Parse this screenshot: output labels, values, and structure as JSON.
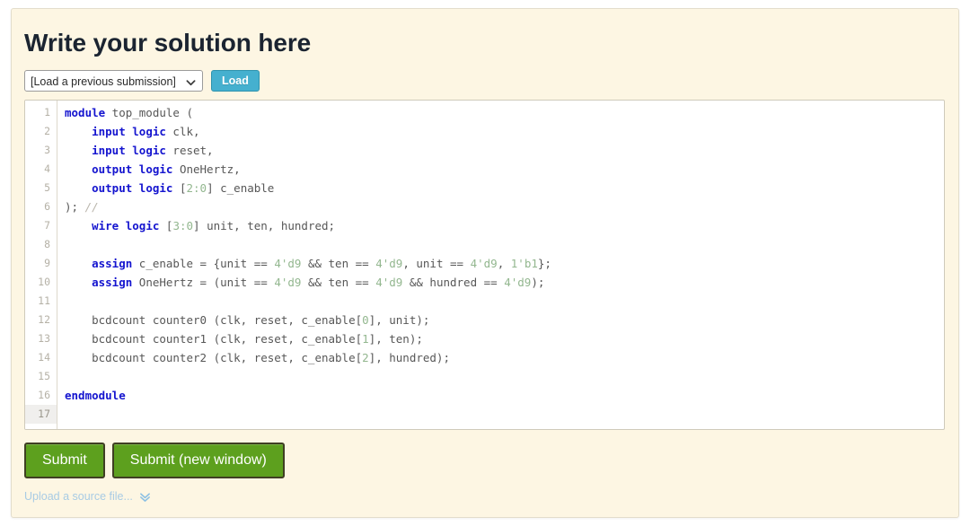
{
  "panel": {
    "title": "Write your solution here"
  },
  "toolbar": {
    "select": {
      "selected": "[Load a previous submission]",
      "options": [
        "[Load a previous submission]"
      ]
    },
    "load_button": "Load"
  },
  "editor": {
    "line_numbers": [
      "1",
      "2",
      "3",
      "4",
      "5",
      "6",
      "7",
      "8",
      "9",
      "10",
      "11",
      "12",
      "13",
      "14",
      "15",
      "16",
      "17"
    ],
    "active_line": 17,
    "language": "systemverilog",
    "colors": {
      "keyword": "#1414cf",
      "number": "#93b78f",
      "comment": "#b9b5ab",
      "plain": "#575757",
      "background": "#ffffff",
      "gutter_text": "#b5b1a6"
    },
    "lines": [
      {
        "n": 1,
        "tokens": [
          {
            "t": "kw",
            "v": "module"
          },
          {
            "t": "plain",
            "v": " top_module ("
          }
        ]
      },
      {
        "n": 2,
        "tokens": [
          {
            "t": "plain",
            "v": "    "
          },
          {
            "t": "kw",
            "v": "input logic"
          },
          {
            "t": "plain",
            "v": " clk,"
          }
        ]
      },
      {
        "n": 3,
        "tokens": [
          {
            "t": "plain",
            "v": "    "
          },
          {
            "t": "kw",
            "v": "input logic"
          },
          {
            "t": "plain",
            "v": " reset,"
          }
        ]
      },
      {
        "n": 4,
        "tokens": [
          {
            "t": "plain",
            "v": "    "
          },
          {
            "t": "kw",
            "v": "output logic"
          },
          {
            "t": "plain",
            "v": " OneHertz,"
          }
        ]
      },
      {
        "n": 5,
        "tokens": [
          {
            "t": "plain",
            "v": "    "
          },
          {
            "t": "kw",
            "v": "output logic"
          },
          {
            "t": "plain",
            "v": " ["
          },
          {
            "t": "num",
            "v": "2:0"
          },
          {
            "t": "plain",
            "v": "] c_enable"
          }
        ]
      },
      {
        "n": 6,
        "tokens": [
          {
            "t": "plain",
            "v": "); "
          },
          {
            "t": "cmt",
            "v": "//"
          }
        ]
      },
      {
        "n": 7,
        "tokens": [
          {
            "t": "plain",
            "v": "    "
          },
          {
            "t": "kw",
            "v": "wire logic"
          },
          {
            "t": "plain",
            "v": " ["
          },
          {
            "t": "num",
            "v": "3:0"
          },
          {
            "t": "plain",
            "v": "] unit, ten, hundred;"
          }
        ]
      },
      {
        "n": 8,
        "tokens": [
          {
            "t": "plain",
            "v": ""
          }
        ]
      },
      {
        "n": 9,
        "tokens": [
          {
            "t": "plain",
            "v": "    "
          },
          {
            "t": "kw",
            "v": "assign"
          },
          {
            "t": "plain",
            "v": " c_enable = {unit == "
          },
          {
            "t": "num",
            "v": "4'd9"
          },
          {
            "t": "plain",
            "v": " && ten == "
          },
          {
            "t": "num",
            "v": "4'd9"
          },
          {
            "t": "plain",
            "v": ", unit == "
          },
          {
            "t": "num",
            "v": "4'd9"
          },
          {
            "t": "plain",
            "v": ", "
          },
          {
            "t": "num",
            "v": "1'b1"
          },
          {
            "t": "plain",
            "v": "};"
          }
        ]
      },
      {
        "n": 10,
        "tokens": [
          {
            "t": "plain",
            "v": "    "
          },
          {
            "t": "kw",
            "v": "assign"
          },
          {
            "t": "plain",
            "v": " OneHertz = (unit == "
          },
          {
            "t": "num",
            "v": "4'd9"
          },
          {
            "t": "plain",
            "v": " && ten == "
          },
          {
            "t": "num",
            "v": "4'd9"
          },
          {
            "t": "plain",
            "v": " && hundred == "
          },
          {
            "t": "num",
            "v": "4'd9"
          },
          {
            "t": "plain",
            "v": ");"
          }
        ]
      },
      {
        "n": 11,
        "tokens": [
          {
            "t": "plain",
            "v": ""
          }
        ]
      },
      {
        "n": 12,
        "tokens": [
          {
            "t": "plain",
            "v": "    bcdcount counter0 (clk, reset, c_enable["
          },
          {
            "t": "num",
            "v": "0"
          },
          {
            "t": "plain",
            "v": "], unit);"
          }
        ]
      },
      {
        "n": 13,
        "tokens": [
          {
            "t": "plain",
            "v": "    bcdcount counter1 (clk, reset, c_enable["
          },
          {
            "t": "num",
            "v": "1"
          },
          {
            "t": "plain",
            "v": "], ten);"
          }
        ]
      },
      {
        "n": 14,
        "tokens": [
          {
            "t": "plain",
            "v": "    bcdcount counter2 (clk, reset, c_enable["
          },
          {
            "t": "num",
            "v": "2"
          },
          {
            "t": "plain",
            "v": "], hundred);"
          }
        ]
      },
      {
        "n": 15,
        "tokens": [
          {
            "t": "plain",
            "v": ""
          }
        ]
      },
      {
        "n": 16,
        "tokens": [
          {
            "t": "kw",
            "v": "endmodule"
          }
        ]
      },
      {
        "n": 17,
        "tokens": [
          {
            "t": "plain",
            "v": ""
          }
        ]
      }
    ]
  },
  "actions": {
    "submit": "Submit",
    "submit_new_window": "Submit (new window)",
    "upload_link": "Upload a source file...",
    "upload_icon": "double-chevron-down-icon"
  },
  "theme": {
    "card_background": "#fdf6e3",
    "load_button": "#45b0cf",
    "submit_button": "#5da01e",
    "link": "#a8cbe4"
  }
}
